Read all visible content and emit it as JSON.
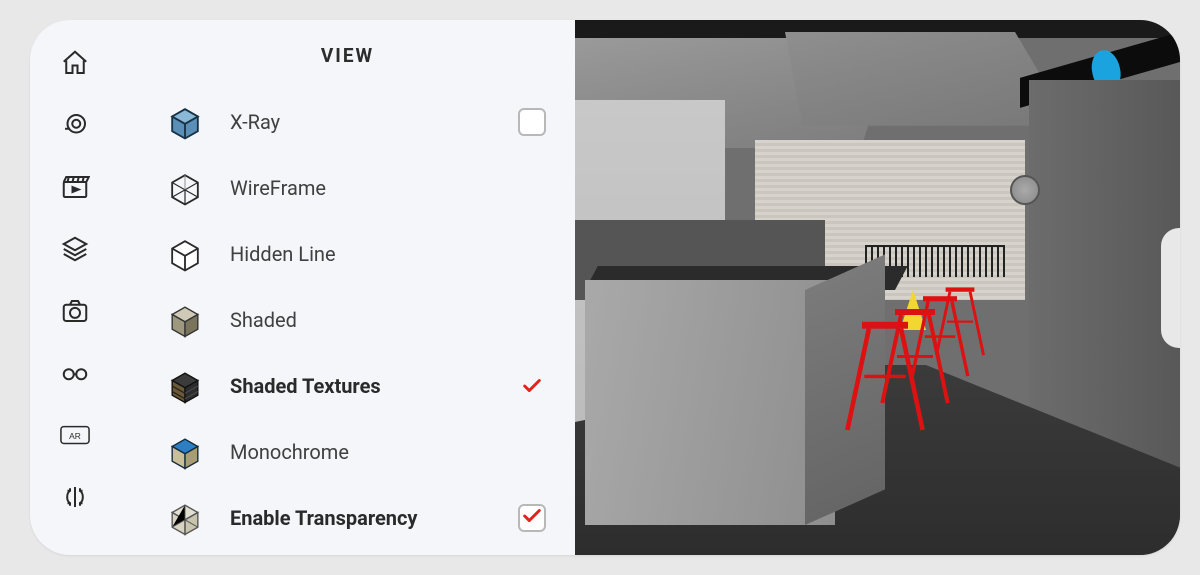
{
  "panel": {
    "title": "VIEW"
  },
  "toolbar": {
    "items": [
      {
        "name": "home"
      },
      {
        "name": "tape-measure"
      },
      {
        "name": "scenes"
      },
      {
        "name": "layers"
      },
      {
        "name": "camera"
      },
      {
        "name": "styles"
      },
      {
        "name": "ar"
      },
      {
        "name": "flip"
      }
    ]
  },
  "view_styles": [
    {
      "id": "xray",
      "label": "X-Ray",
      "selected": false,
      "has_checkbox": true,
      "checkbox_checked": false
    },
    {
      "id": "wireframe",
      "label": "WireFrame",
      "selected": false,
      "has_checkbox": false
    },
    {
      "id": "hidden_line",
      "label": "Hidden Line",
      "selected": false,
      "has_checkbox": false
    },
    {
      "id": "shaded",
      "label": "Shaded",
      "selected": false,
      "has_checkbox": false
    },
    {
      "id": "shaded_textures",
      "label": "Shaded Textures",
      "selected": true,
      "has_checkbox": false
    },
    {
      "id": "monochrome",
      "label": "Monochrome",
      "selected": false,
      "has_checkbox": false
    },
    {
      "id": "enable_transparency",
      "label": "Enable Transparency",
      "selected": false,
      "bold": true,
      "has_checkbox": true,
      "checkbox_checked": true
    }
  ],
  "colors": {
    "accent": "#e2231a",
    "panel_bg": "#f5f6fa",
    "outer_bg": "#e8e8e8"
  }
}
